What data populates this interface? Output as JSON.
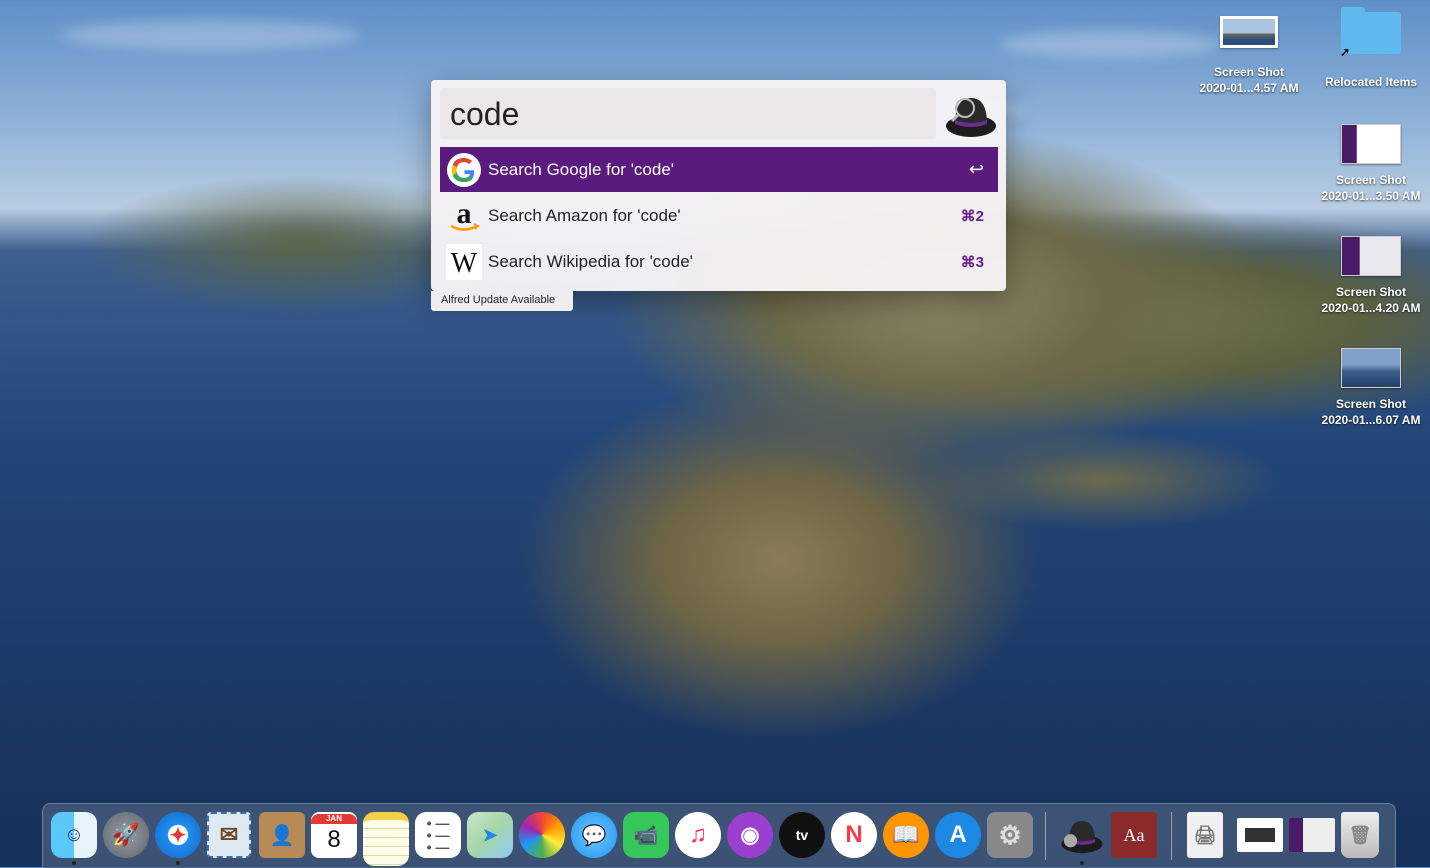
{
  "alfred": {
    "query": "code",
    "results": [
      {
        "label": "Search Google for 'code'",
        "shortcut": "↩",
        "icon": "google-icon",
        "selected": true
      },
      {
        "label": "Search Amazon for 'code'",
        "shortcut": "⌘2",
        "icon": "amazon-icon",
        "selected": false
      },
      {
        "label": "Search Wikipedia for 'code'",
        "shortcut": "⌘3",
        "icon": "wikipedia-icon",
        "selected": false
      }
    ],
    "update_notice": "Alfred Update Available",
    "accent_color": "#5b1a7d"
  },
  "desktop": {
    "items": [
      {
        "name": "Screen Shot",
        "sub": "2020-01...4.57 AM"
      },
      {
        "name": "Relocated Items",
        "sub": ""
      },
      {
        "name": "Screen Shot",
        "sub": "2020-01...3.50 AM"
      },
      {
        "name": "Screen Shot",
        "sub": "2020-01...4.20 AM"
      },
      {
        "name": "Screen Shot",
        "sub": "2020-01...6.07 AM"
      }
    ]
  },
  "dock": {
    "calendar_month": "JAN",
    "calendar_day": "8",
    "apple_tv_label": "tv",
    "dictionary_label": "Aa",
    "items": [
      "finder-icon",
      "launchpad-icon",
      "safari-icon",
      "mail-icon",
      "contacts-icon",
      "calendar-icon",
      "notes-icon",
      "reminders-icon",
      "maps-icon",
      "photos-icon",
      "messages-icon",
      "facetime-icon",
      "music-icon",
      "podcasts-icon",
      "apple-tv-icon",
      "news-icon",
      "books-icon",
      "app-store-icon",
      "system-preferences-icon",
      "alfred-icon",
      "dictionary-icon",
      "preview-doc-icon",
      "screenshot-stack-icon",
      "screenshot-stack-2-icon",
      "trash-icon"
    ]
  }
}
